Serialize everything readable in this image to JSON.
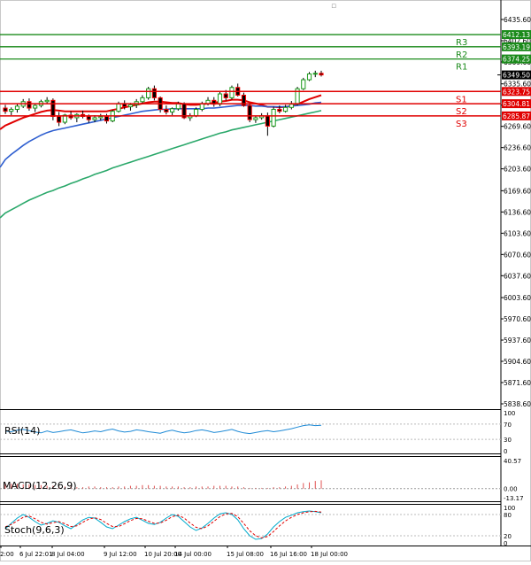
{
  "colors": {
    "background": "#ffffff",
    "bull_candle": "#1a9a1a",
    "bear_candle": "#ff0000",
    "support_line": "#e00000",
    "resistance_line": "#1a8a1a",
    "ma_fast": "#e00000",
    "ma_mid": "#2f5fd0",
    "ma_slow": "#2aa86a",
    "rsi": "#1e8ad6",
    "macd_hist": "#e05050",
    "stoch_main": "#00aacc",
    "stoch_signal": "#e00000",
    "label_red_bg": "#e00000",
    "label_green_bg": "#1a8a1a",
    "label_dark_bg": "#000000"
  },
  "chart_data": {
    "type": "candlestick",
    "price_axis": {
      "ticks": [
        "6435.60",
        "6402.60",
        "6369.60",
        "6335.60",
        "6302.60",
        "6269.60",
        "6236.60",
        "6203.60",
        "6169.60",
        "6136.60",
        "6103.60",
        "6070.60",
        "6037.60",
        "6003.60",
        "5970.60",
        "5937.60",
        "5904.60",
        "5871.60",
        "5838.60"
      ],
      "ylim": [
        5838.6,
        6435.6
      ]
    },
    "time_axis": {
      "labels": [
        "2:00",
        "6 Jul 22:01",
        "8 Jul 04:00",
        "9 Jul 12:00",
        "10 Jul 20:00",
        "14 Jul 00:00",
        "15 Jul 08:00",
        "16 Jul 16:00",
        "18 Jul 00:00"
      ]
    },
    "levels": [
      {
        "name": "R3",
        "value": 6412.13,
        "price_label": "6412.13",
        "kind": "resistance"
      },
      {
        "name": "",
        "value": 6393.19,
        "price_label": "6393.19",
        "kind": "resistance"
      },
      {
        "name": "R2",
        "value": 6374.25,
        "price_label": "6374.25",
        "kind": "resistance"
      },
      {
        "name": "R1",
        "value": 6374.25,
        "price_label": "",
        "kind": "label_only"
      },
      {
        "name": "S1",
        "value": 6323.75,
        "price_label": "6323.75",
        "kind": "support"
      },
      {
        "name": "S2",
        "value": 6304.81,
        "price_label": "6304.81",
        "kind": "support"
      },
      {
        "name": "S3",
        "value": 6285.87,
        "price_label": "6285.87",
        "kind": "support"
      }
    ],
    "current_price": {
      "value": 6349.5,
      "label": "6349.50"
    },
    "candles": [
      [
        6298,
        6303,
        6289,
        6293
      ],
      [
        6293,
        6299,
        6287,
        6296
      ],
      [
        6296,
        6305,
        6291,
        6301
      ],
      [
        6301,
        6312,
        6298,
        6308
      ],
      [
        6308,
        6313,
        6294,
        6298
      ],
      [
        6298,
        6305,
        6292,
        6302
      ],
      [
        6302,
        6311,
        6299,
        6308
      ],
      [
        6308,
        6315,
        6305,
        6310
      ],
      [
        6310,
        6313,
        6279,
        6285
      ],
      [
        6285,
        6292,
        6270,
        6276
      ],
      [
        6276,
        6289,
        6273,
        6287
      ],
      [
        6287,
        6293,
        6280,
        6283
      ],
      [
        6283,
        6290,
        6276,
        6288
      ],
      [
        6288,
        6294,
        6282,
        6285
      ],
      [
        6285,
        6288,
        6275,
        6280
      ],
      [
        6280,
        6287,
        6276,
        6283
      ],
      [
        6283,
        6289,
        6279,
        6285
      ],
      [
        6285,
        6289,
        6274,
        6278
      ],
      [
        6278,
        6295,
        6276,
        6293
      ],
      [
        6293,
        6308,
        6291,
        6305
      ],
      [
        6305,
        6310,
        6296,
        6300
      ],
      [
        6300,
        6306,
        6294,
        6303
      ],
      [
        6303,
        6312,
        6298,
        6308
      ],
      [
        6308,
        6318,
        6305,
        6314
      ],
      [
        6314,
        6331,
        6311,
        6328
      ],
      [
        6328,
        6333,
        6310,
        6314
      ],
      [
        6314,
        6316,
        6291,
        6296
      ],
      [
        6296,
        6302,
        6288,
        6292
      ],
      [
        6292,
        6299,
        6287,
        6297
      ],
      [
        6297,
        6308,
        6294,
        6305
      ],
      [
        6305,
        6307,
        6281,
        6283
      ],
      [
        6283,
        6290,
        6278,
        6286
      ],
      [
        6286,
        6299,
        6284,
        6296
      ],
      [
        6296,
        6308,
        6293,
        6305
      ],
      [
        6305,
        6315,
        6302,
        6310
      ],
      [
        6310,
        6315,
        6300,
        6304
      ],
      [
        6304,
        6323,
        6301,
        6320
      ],
      [
        6320,
        6326,
        6310,
        6314
      ],
      [
        6314,
        6333,
        6311,
        6330
      ],
      [
        6330,
        6336,
        6316,
        6318
      ],
      [
        6318,
        6322,
        6300,
        6302
      ],
      [
        6302,
        6305,
        6276,
        6280
      ],
      [
        6280,
        6286,
        6275,
        6283
      ],
      [
        6283,
        6290,
        6280,
        6286
      ],
      [
        6286,
        6291,
        6255,
        6270
      ],
      [
        6270,
        6300,
        6268,
        6296
      ],
      [
        6296,
        6302,
        6290,
        6293
      ],
      [
        6293,
        6303,
        6291,
        6299
      ],
      [
        6299,
        6309,
        6296,
        6304
      ],
      [
        6304,
        6331,
        6302,
        6328
      ],
      [
        6328,
        6345,
        6326,
        6342
      ],
      [
        6342,
        6354,
        6340,
        6351
      ],
      [
        6351,
        6356,
        6346,
        6352
      ],
      [
        6352,
        6356,
        6347,
        6349.5
      ]
    ],
    "series": [
      {
        "name": "",
        "values": [
          6271,
          6275,
          6279,
          6283,
          6286,
          6289,
          6292,
          6294,
          6295,
          6294,
          6293,
          6293,
          6293,
          6293,
          6293,
          6293,
          6293,
          6293,
          6295,
          6297,
          6299,
          6301,
          6303,
          6305,
          6307,
          6308,
          6308,
          6307,
          6306,
          6306,
          6304,
          6303,
          6303,
          6304,
          6305,
          6306,
          6308,
          6309,
          6311,
          6311,
          6310,
          6307,
          6305,
          6303,
          6300,
          6300,
          6299,
          6300,
          6301,
          6304,
          6308,
          6312,
          6315,
          6318
        ]
      },
      {
        "name": "",
        "values": [
          6218,
          6226,
          6233,
          6240,
          6246,
          6251,
          6256,
          6260,
          6263,
          6265,
          6267,
          6269,
          6271,
          6273,
          6275,
          6277,
          6279,
          6281,
          6283,
          6285,
          6287,
          6289,
          6291,
          6293,
          6294,
          6295,
          6296,
          6296,
          6297,
          6297,
          6297,
          6297,
          6297,
          6297,
          6298,
          6298,
          6299,
          6300,
          6301,
          6302,
          6302,
          6302,
          6301,
          6301,
          6300,
          6300,
          6300,
          6300,
          6301,
          6302,
          6303,
          6304,
          6306,
          6307
        ]
      },
      {
        "name": "",
        "values": [
          6135,
          6140,
          6145,
          6150,
          6155,
          6159,
          6163,
          6167,
          6170,
          6174,
          6177,
          6181,
          6184,
          6188,
          6191,
          6195,
          6198,
          6201,
          6205,
          6208,
          6211,
          6214,
          6217,
          6220,
          6223,
          6226,
          6229,
          6232,
          6235,
          6238,
          6241,
          6244,
          6247,
          6250,
          6253,
          6256,
          6259,
          6261,
          6264,
          6266,
          6268,
          6270,
          6272,
          6274,
          6276,
          6278,
          6280,
          6282,
          6284,
          6286,
          6288,
          6290,
          6292,
          6294
        ]
      }
    ]
  },
  "indicators": {
    "rsi": {
      "label": "RSI(14)",
      "ticks": [
        "100",
        "70",
        "30",
        "0"
      ],
      "ylim": [
        0,
        100
      ],
      "values": [
        52,
        50,
        54,
        56,
        53,
        49,
        47,
        52,
        48,
        50,
        53,
        55,
        51,
        47,
        49,
        52,
        50,
        54,
        57,
        52,
        49,
        51,
        55,
        53,
        50,
        48,
        46,
        51,
        54,
        50,
        47,
        49,
        53,
        55,
        52,
        48,
        50,
        53,
        56,
        51,
        47,
        45,
        48,
        51,
        53,
        50,
        52,
        55,
        58,
        62,
        66,
        68,
        66,
        67
      ]
    },
    "macd": {
      "label": "MACD(12,26,9)",
      "ticks": [
        "40.57",
        "0.00",
        "-13.17"
      ],
      "ylim": [
        -13.17,
        40.57
      ],
      "values": [
        8,
        7,
        7,
        6,
        6,
        5,
        5,
        4,
        4,
        3,
        3,
        3,
        2,
        2,
        3,
        3,
        2,
        2,
        2,
        3,
        3,
        4,
        4,
        5,
        5,
        4,
        4,
        3,
        3,
        3,
        2,
        2,
        3,
        3,
        3,
        4,
        4,
        4,
        3,
        3,
        2,
        1,
        1,
        1,
        1,
        2,
        2,
        3,
        4,
        6,
        8,
        9,
        11,
        12
      ]
    },
    "stoch": {
      "label": "Stoch(9,6,3)",
      "ticks": [
        "100",
        "80",
        "20",
        "0"
      ],
      "ylim": [
        0,
        100
      ],
      "main": [
        40,
        55,
        70,
        80,
        72,
        60,
        50,
        55,
        62,
        58,
        48,
        40,
        52,
        65,
        72,
        70,
        58,
        45,
        40,
        50,
        60,
        68,
        72,
        64,
        55,
        52,
        58,
        70,
        80,
        75,
        60,
        45,
        35,
        42,
        55,
        70,
        82,
        85,
        80,
        65,
        40,
        20,
        10,
        12,
        25,
        45,
        60,
        72,
        78,
        85,
        88,
        90,
        88,
        85
      ],
      "signal": [
        45,
        52,
        62,
        72,
        76,
        68,
        58,
        53,
        57,
        60,
        54,
        46,
        48,
        58,
        67,
        71,
        66,
        55,
        46,
        46,
        54,
        63,
        69,
        68,
        61,
        55,
        56,
        64,
        74,
        78,
        70,
        56,
        44,
        40,
        48,
        61,
        74,
        82,
        83,
        74,
        55,
        34,
        20,
        14,
        18,
        32,
        48,
        62,
        72,
        80,
        85,
        88,
        89,
        87
      ]
    }
  }
}
